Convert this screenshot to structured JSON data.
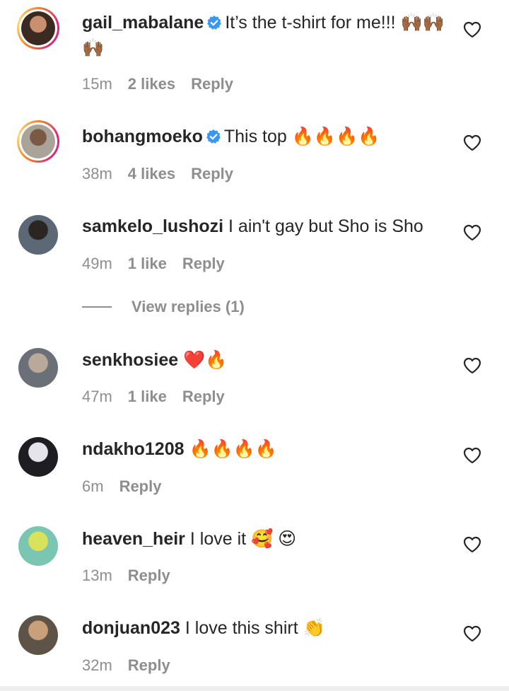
{
  "comments": [
    {
      "username": "gail_mabalane",
      "verified": true,
      "ring": true,
      "text": "It’s the t-shirt for me!!! 🙌🏾🙌🏾🙌🏾",
      "time": "15m",
      "likes": "2 likes",
      "reply": "Reply",
      "avatar_colors": [
        "#3b2a22",
        "#c98f6e"
      ]
    },
    {
      "username": "bohangmoeko",
      "verified": true,
      "ring": true,
      "text": "This top 🔥🔥🔥🔥",
      "time": "38m",
      "likes": "4 likes",
      "reply": "Reply",
      "avatar_colors": [
        "#a9a39a",
        "#7a5a45"
      ]
    },
    {
      "username": "samkelo_lushozi",
      "verified": false,
      "ring": false,
      "text": "I ain't gay but Sho is Sho",
      "time": "49m",
      "likes": "1 like",
      "reply": "Reply",
      "view_replies": "View replies (1)",
      "avatar_colors": [
        "#5d6877",
        "#2b2622"
      ]
    },
    {
      "username": "senkhosiee",
      "verified": false,
      "ring": false,
      "text": "❤️🔥",
      "time": "47m",
      "likes": "1 like",
      "reply": "Reply",
      "avatar_colors": [
        "#6b6f77",
        "#b9a99b"
      ]
    },
    {
      "username": "ndakho1208",
      "verified": false,
      "ring": false,
      "text": "🔥🔥🔥🔥",
      "time": "6m",
      "likes": "",
      "reply": "Reply",
      "avatar_colors": [
        "#1d1d22",
        "#e4e4ea"
      ]
    },
    {
      "username": "heaven_heir",
      "verified": false,
      "ring": false,
      "text": "I love it 🥰 😍",
      "time": "13m",
      "likes": "",
      "reply": "Reply",
      "avatar_colors": [
        "#7bc6b2",
        "#d8e25a"
      ]
    },
    {
      "username": "donjuan023",
      "verified": false,
      "ring": false,
      "text": "I love this shirt 👏",
      "time": "32m",
      "likes": "",
      "reply": "Reply",
      "avatar_colors": [
        "#5d5347",
        "#c9a07a"
      ]
    }
  ],
  "colors": {
    "text": "#262626",
    "muted": "#8e8e8e",
    "verified": "#3897f0"
  },
  "icons": {
    "like": "heart-outline-icon",
    "verified": "verified-badge-icon"
  }
}
